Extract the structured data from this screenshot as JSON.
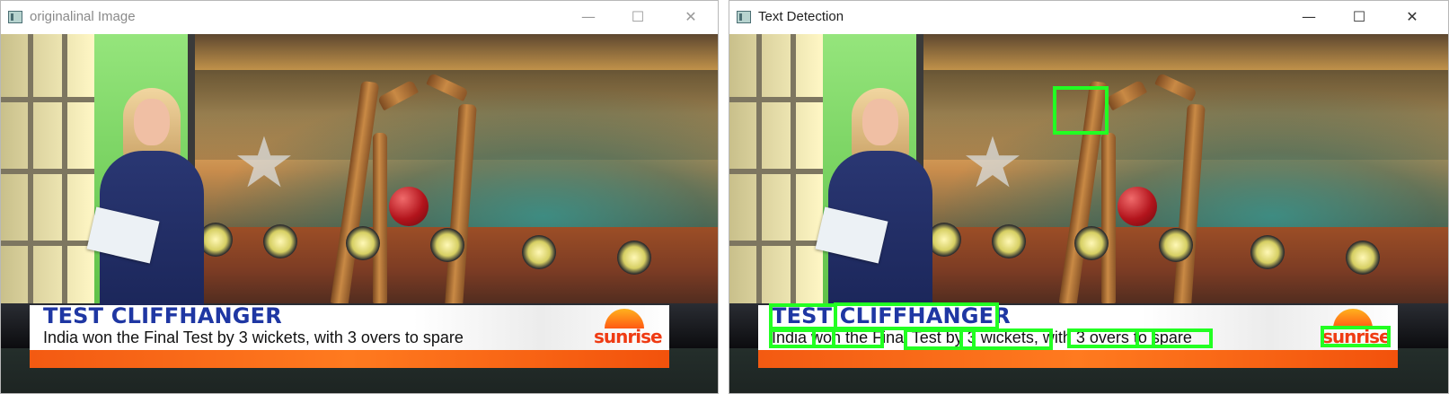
{
  "windows": [
    {
      "title": "originalinal Image",
      "controls": {
        "minimize": "—",
        "maximize": "☐",
        "close": "✕"
      }
    },
    {
      "title": "Text Detection",
      "controls": {
        "minimize": "—",
        "maximize": "☐",
        "close": "✕"
      }
    }
  ],
  "broadcast": {
    "headline": "TEST CLIFFHANGER",
    "subline": "India won the Final Test by 3 wickets, with 3 overs to spare",
    "logo": "sunrise"
  },
  "colors": {
    "detection_box": "#22ff22",
    "headline": "#1f37a3",
    "ticker_bar": "#f35a12",
    "logo": "#ef3b13"
  },
  "detections_count_shown": 11
}
